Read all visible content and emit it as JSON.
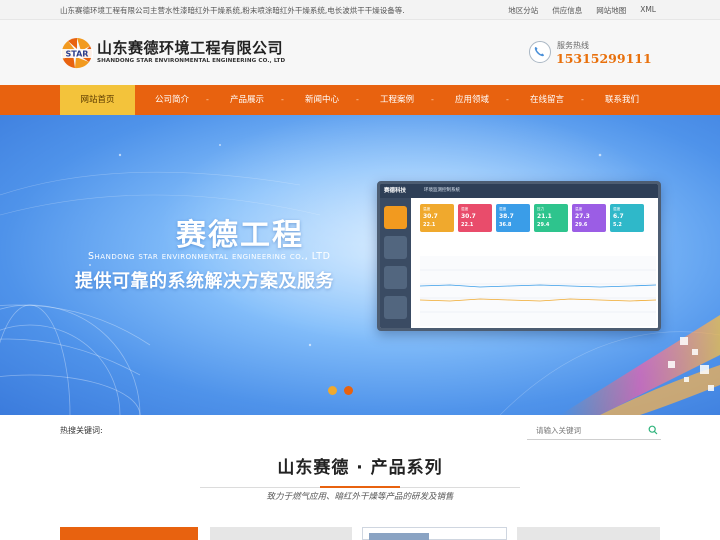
{
  "topbar": {
    "intro": "山东赛德环境工程有限公司主营水性漆暗红外干燥系统,粉末喷涂暗红外干燥系统,电长波烘干干燥设备等.",
    "links": [
      "地区分站",
      "供应信息",
      "网站地图",
      "XML"
    ]
  },
  "header": {
    "logo_text": "STAR",
    "company_cn": "山东赛德环境工程有限公司",
    "company_en": "SHANDONG STAR ENVIRONMENTAL ENGINEERING CO., LTD",
    "hotline_label": "服务热线",
    "hotline_number": "15315299111"
  },
  "nav": {
    "items": [
      "网站首页",
      "公司简介",
      "产品展示",
      "新闻中心",
      "工程案例",
      "应用领域",
      "在线留言",
      "联系我们"
    ],
    "separator": "-",
    "active_index": 0
  },
  "banner": {
    "title": "赛德工程",
    "subtitle_en": "Shandong star environmental engineering co., LTD",
    "slogan": "提供可靠的系统解决方案及服务",
    "monitor": {
      "brand": "赛德科技",
      "title": "环境监测控制系统",
      "tiles": [
        {
          "label": "温度",
          "value": "30.7",
          "value2": "22.1",
          "color": "#f0a92d"
        },
        {
          "label": "湿度",
          "value": "30.7",
          "value2": "22.1",
          "color": "#e94c6b"
        },
        {
          "label": "湿度",
          "value": "38.7",
          "value2": "36.8",
          "color": "#3a9de8"
        },
        {
          "label": "压力",
          "value": "21.1",
          "value2": "29.4",
          "color": "#2ec48d"
        },
        {
          "label": "温度",
          "value": "27.3",
          "value2": "29.6",
          "color": "#9b5de5"
        },
        {
          "label": "湿度",
          "value": "6.7",
          "value2": "5.2",
          "color": "#2fb8c9"
        }
      ]
    },
    "slide_count": 2,
    "active_slide": 1
  },
  "search": {
    "hot_label": "热搜关键词:",
    "placeholder": "请输入关键词"
  },
  "products": {
    "title": "山东赛德 · 产品系列",
    "subtitle": "致力于燃气应用、暗红外干燥等产品的研发及销售"
  },
  "colors": {
    "brand_orange": "#e8620f",
    "nav_active": "#f3c33b",
    "hotline": "#e8700c"
  }
}
